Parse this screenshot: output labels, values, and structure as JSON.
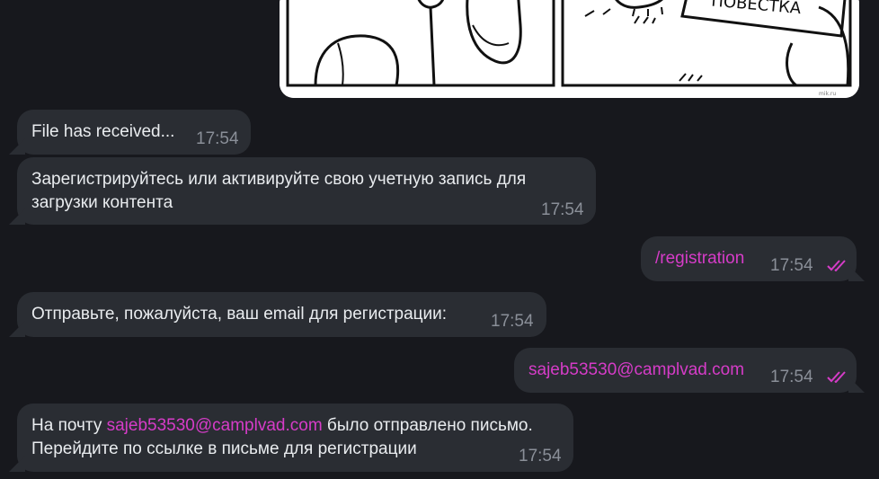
{
  "messages": {
    "file_received": {
      "text": "File has received...",
      "time": "17:54"
    },
    "register_prompt": {
      "text": "Зарегистрируйтесь или активируйте свою учетную запись для загрузки контента",
      "time": "17:54"
    },
    "cmd_registration": {
      "text": "/registration",
      "time": "17:54"
    },
    "send_email_prompt": {
      "text": "Отправьте, пожалуйста, ваш email для регистрации:",
      "time": "17:54"
    },
    "user_email": {
      "text": "sajeb53530@camplvad.com",
      "time": "17:54"
    },
    "confirmation": {
      "prefix": "На почту ",
      "email": "sajeb53530@camplvad.com",
      "suffix": " было отправлено письмо.",
      "line2": "Перейдите по ссылке в письме для регистрации",
      "time": "17:54"
    }
  },
  "comic_caption": "ПОВЕСТКА",
  "colors": {
    "background": "#17181d",
    "bubble": "#2a2d33",
    "accent": "#d63cc8",
    "time": "#8a8f98"
  },
  "icons": {
    "read_status": "double-check-icon"
  }
}
